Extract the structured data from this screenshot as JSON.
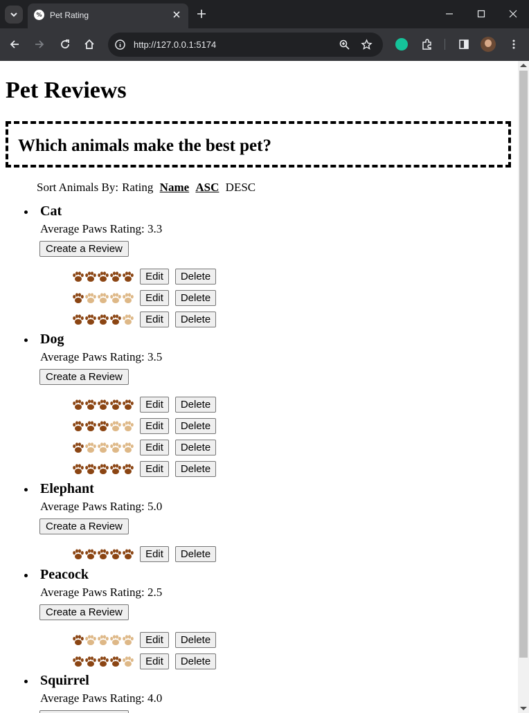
{
  "browser": {
    "tab_title": "Pet Rating",
    "favicon_text": "%",
    "url": "http://127.0.0.1:5174"
  },
  "page": {
    "title": "Pet Reviews",
    "question": "Which animals make the best pet?",
    "sort": {
      "label": "Sort Animals By:",
      "options": [
        "Rating",
        "Name",
        "ASC",
        "DESC"
      ],
      "active": [
        "Name",
        "ASC"
      ]
    },
    "avg_label": "Average Paws Rating:",
    "create_label": "Create a Review",
    "edit_label": "Edit",
    "delete_label": "Delete",
    "colors": {
      "paw_filled": "#8b4513",
      "paw_empty": "#deb887"
    },
    "animals": [
      {
        "name": "Cat",
        "average": "3.3",
        "reviews": [
          5,
          1,
          4
        ]
      },
      {
        "name": "Dog",
        "average": "3.5",
        "reviews": [
          5,
          3,
          1,
          5
        ]
      },
      {
        "name": "Elephant",
        "average": "5.0",
        "reviews": [
          5
        ]
      },
      {
        "name": "Peacock",
        "average": "2.5",
        "reviews": [
          1,
          4
        ]
      },
      {
        "name": "Squirrel",
        "average": "4.0",
        "reviews": []
      }
    ]
  }
}
